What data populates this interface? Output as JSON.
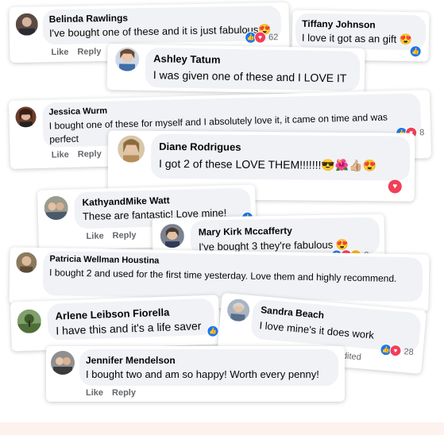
{
  "actions": {
    "like": "Like",
    "reply": "Reply"
  },
  "comments": [
    {
      "name": "Belinda Rawlings",
      "text": "I've bought one of these and it is just fabulous",
      "emoji": "😍",
      "count": "62"
    },
    {
      "name": "Tiffany Johnson",
      "text": "I love it got as an gift",
      "emoji": "😍"
    },
    {
      "name": "Ashley Tatum",
      "text": "I was given one of these and I LOVE IT"
    },
    {
      "name": "Jessica Wurm",
      "text": "I bought one of these for myself and I absolutely love it, it came on time and was perfect",
      "count": "8"
    },
    {
      "name": "Diane Rodrigues",
      "text": "I got 2 of these LOVE THEM!!!!!!!",
      "emoji": "😎🌺👍🏼😍"
    },
    {
      "name": "KathyandMike Watt",
      "text": "These are fantastic! Love mine!"
    },
    {
      "name": "Mary Kirk Mccafferty",
      "text": "I've bought 3 they're fabulous",
      "emoji": "😍",
      "count": "8"
    },
    {
      "name": "Patricia Wellman Houstina",
      "text": "I bought 2 and used for the first time yesterday. Love them and highly recommend."
    },
    {
      "name": "Arlene Leibson Fiorella",
      "text": "I have this and it's a life saver"
    },
    {
      "name": "Sandra Beach",
      "text": "I love mine's it does work",
      "count": "28",
      "edited": "Edited"
    },
    {
      "name": "Jennifer Mendelson",
      "text": "I bought two and am so happy! Worth every penny!"
    }
  ]
}
